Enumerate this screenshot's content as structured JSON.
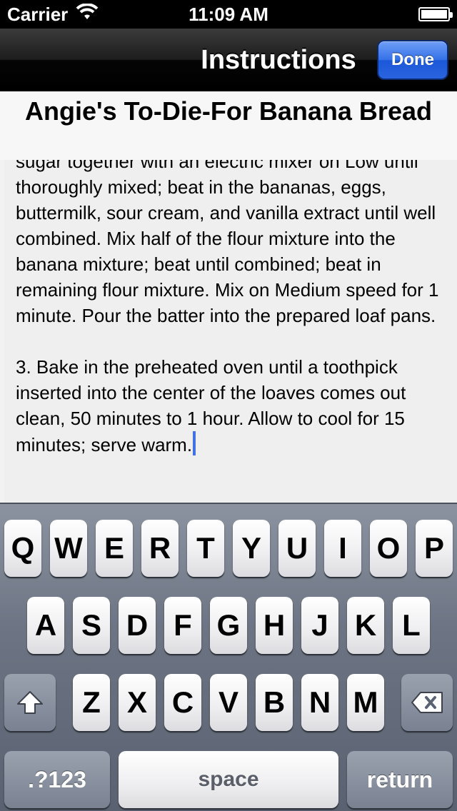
{
  "status_bar": {
    "carrier": "Carrier",
    "time": "11:09 AM",
    "wifi_icon": "wifi-icon",
    "battery_icon": "battery-icon"
  },
  "nav_bar": {
    "title": "Instructions",
    "done_label": "Done"
  },
  "recipe": {
    "title": "Angie's To-Die-For Banana Bread",
    "body": "sugar together with an electric mixer on Low until thoroughly mixed; beat in the bananas, eggs, buttermilk, sour cream, and vanilla extract until well combined. Mix half of the flour mixture into the banana mixture; beat until combined; beat in remaining flour mixture. Mix on Medium speed for 1 minute. Pour the batter into the prepared loaf pans.\n\n3. Bake in the preheated oven until a toothpick inserted into the center of the loaves comes out clean, 50 minutes to 1 hour. Allow to cool for 15 minutes; serve warm."
  },
  "keyboard": {
    "row1": [
      "Q",
      "W",
      "E",
      "R",
      "T",
      "Y",
      "U",
      "I",
      "O",
      "P"
    ],
    "row2": [
      "A",
      "S",
      "D",
      "F",
      "G",
      "H",
      "J",
      "K",
      "L"
    ],
    "row3": [
      "Z",
      "X",
      "C",
      "V",
      "B",
      "N",
      "M"
    ],
    "shift_icon": "shift-icon",
    "delete_icon": "delete-icon",
    "numbers_label": ".?123",
    "space_label": "space",
    "return_label": "return"
  },
  "colors": {
    "done_button": "#2a63df",
    "cursor": "#4471e6"
  }
}
